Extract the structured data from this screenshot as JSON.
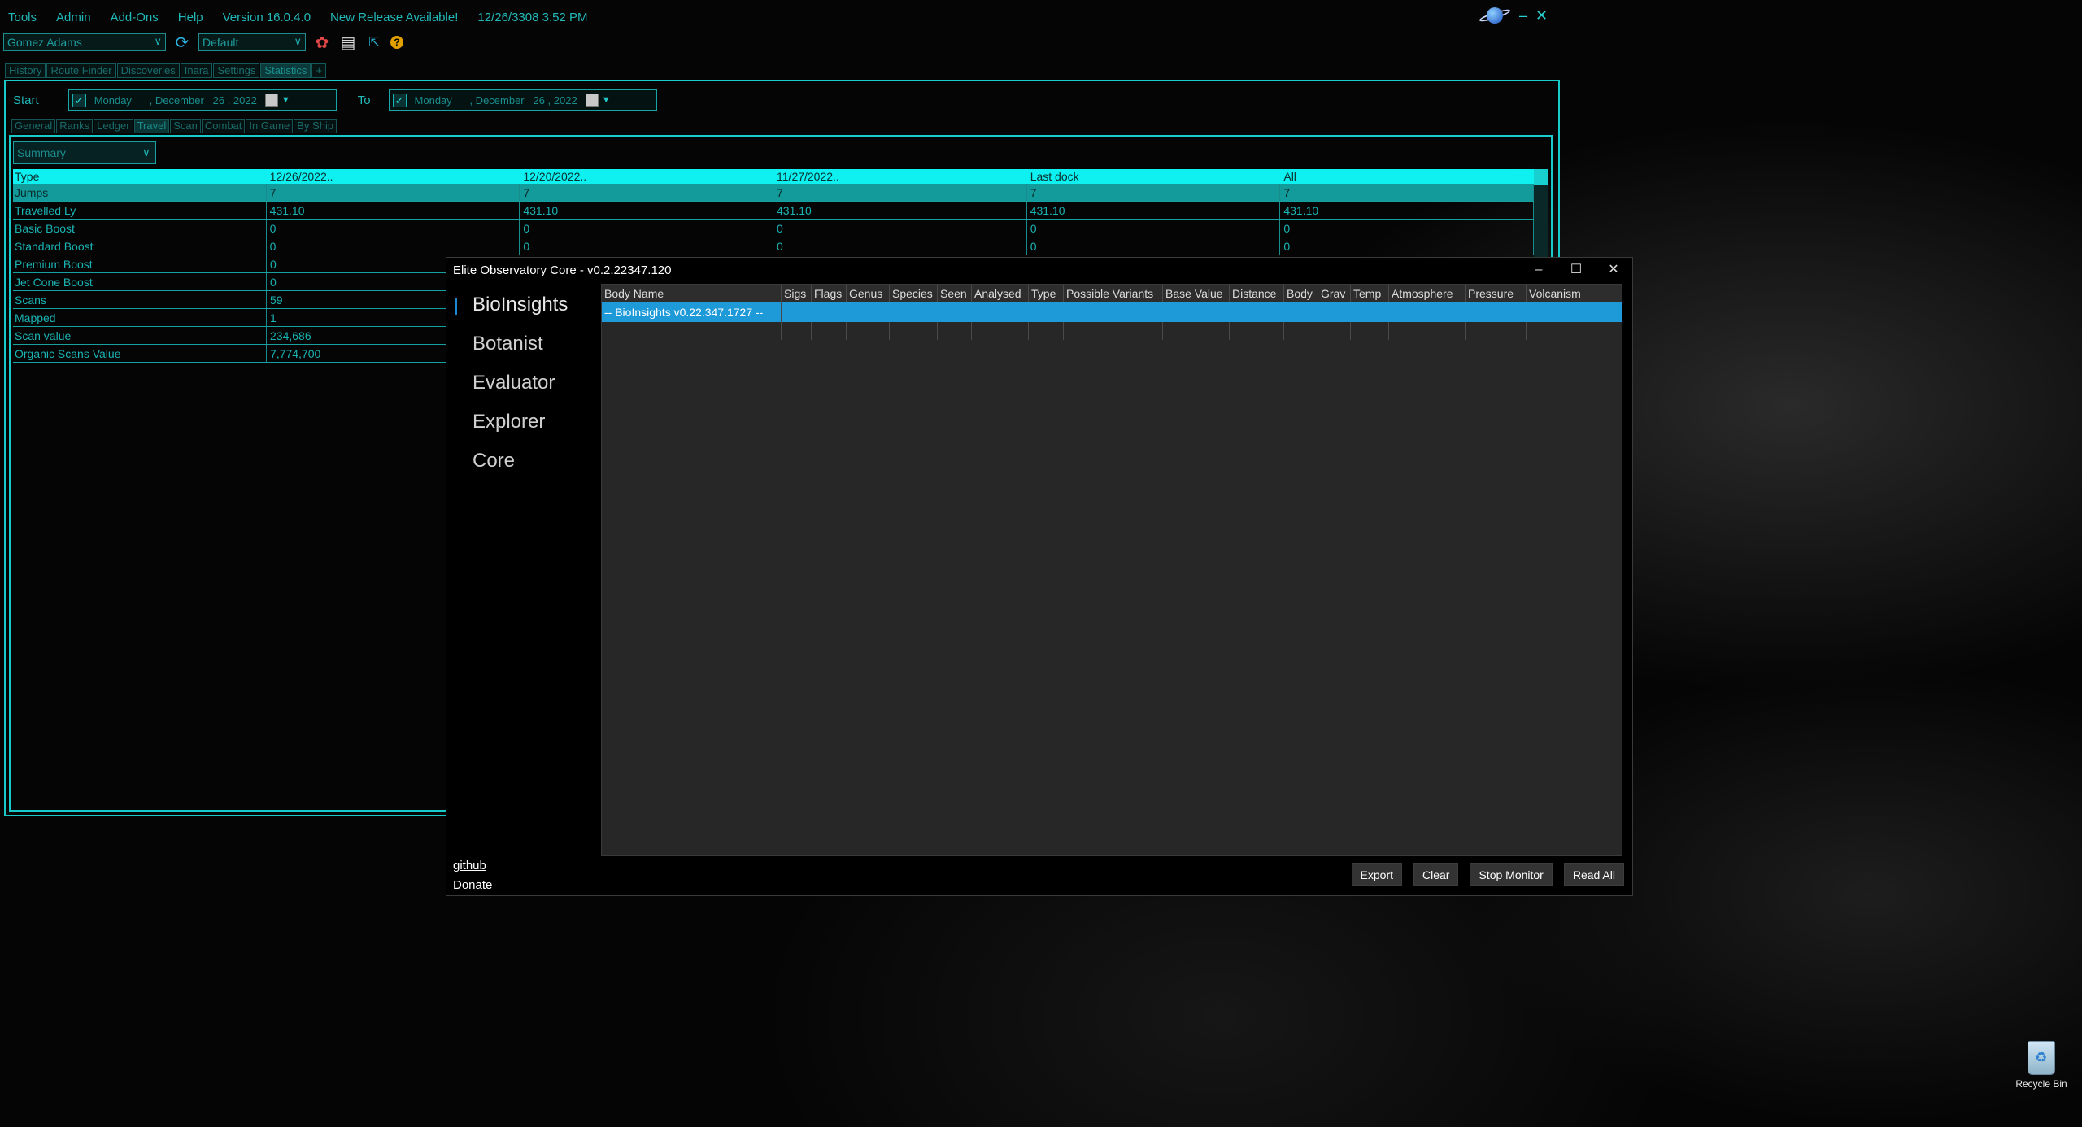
{
  "ed": {
    "menu": [
      "Tools",
      "Admin",
      "Add-Ons",
      "Help",
      "Version 16.0.4.0",
      "New Release Available!",
      "12/26/3308 3:52 PM"
    ],
    "commander": "Gomez Adams",
    "profile": "Default",
    "tabs": [
      "History",
      "Route Finder",
      "Discoveries",
      "Inara",
      "Settings",
      "Statistics",
      "+"
    ],
    "active_tab": "Statistics",
    "start_label": "Start",
    "to_label": "To",
    "start_date": "Monday      , December   26 , 2022",
    "to_date": "Monday      , December   26 , 2022",
    "sub_tabs": [
      "General",
      "Ranks",
      "Ledger",
      "Travel",
      "Scan",
      "Combat",
      "In Game",
      "By Ship"
    ],
    "active_sub_tab": "Travel",
    "summary_label": "Summary",
    "stats": {
      "headers": [
        "Type",
        "12/26/2022..",
        "12/20/2022..",
        "11/27/2022..",
        "Last dock",
        "All"
      ],
      "rows": [
        [
          "Jumps",
          "7",
          "7",
          "7",
          "7",
          "7"
        ],
        [
          "Travelled Ly",
          "431.10",
          "431.10",
          "431.10",
          "431.10",
          "431.10"
        ],
        [
          "Basic Boost",
          "0",
          "0",
          "0",
          "0",
          "0"
        ],
        [
          "Standard Boost",
          "0",
          "0",
          "0",
          "0",
          "0"
        ],
        [
          "Premium Boost",
          "0"
        ],
        [
          "Jet Cone Boost",
          "0"
        ],
        [
          "Scans",
          "59"
        ],
        [
          "Mapped",
          "1"
        ],
        [
          "Scan value",
          "234,686"
        ],
        [
          "Organic Scans Value",
          "7,774,700"
        ]
      ]
    }
  },
  "obs": {
    "title": "Elite Observatory Core - v0.2.22347.120",
    "nav": [
      "BioInsights",
      "Botanist",
      "Evaluator",
      "Explorer",
      "Core"
    ],
    "selected_nav": "BioInsights",
    "columns": [
      "Body Name",
      "Sigs",
      "Flags",
      "Genus",
      "Species",
      "Seen",
      "Analysed",
      "Type",
      "Possible Variants",
      "Base Value",
      "Distance",
      "Body",
      "Grav",
      "Temp",
      "Atmosphere",
      "Pressure",
      "Volcanism"
    ],
    "row": "-- BioInsights v0.22.347.1727 --",
    "links": [
      "github",
      "Donate"
    ],
    "buttons": [
      "Export",
      "Clear",
      "Stop Monitor",
      "Read All"
    ]
  },
  "desktop": {
    "recycle_bin": "Recycle Bin"
  }
}
